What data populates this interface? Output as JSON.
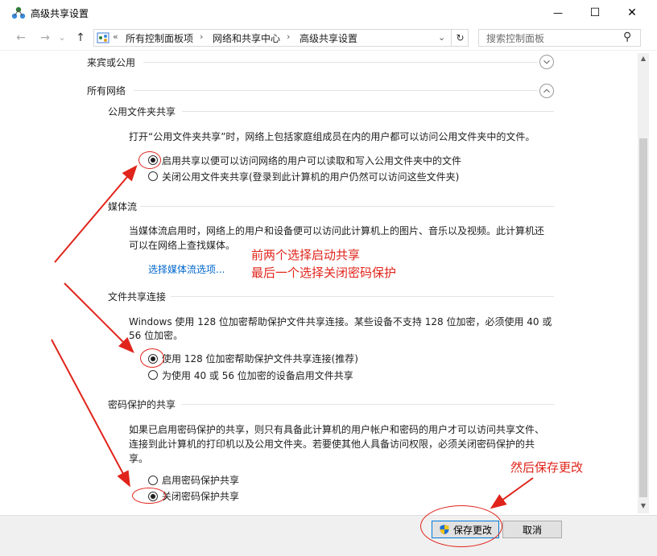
{
  "window": {
    "title": "高级共享设置",
    "minimize_glyph": "—",
    "maximize_glyph": "☐",
    "close_glyph": "✕"
  },
  "nav": {
    "back_glyph": "←",
    "forward_glyph": "→",
    "dropdown_glyph": "⌄",
    "up_glyph": "↑",
    "breadcrumb_prefix": "«",
    "breadcrumbs": [
      "所有控制面板项",
      "网络和共享中心",
      "高级共享设置"
    ],
    "refresh_glyph": "↻",
    "search_placeholder": "搜索控制面板",
    "search_glyph": "⚲"
  },
  "sections": {
    "guest": {
      "label": "来宾或公用"
    },
    "all": {
      "label": "所有网络"
    }
  },
  "public_folder": {
    "heading": "公用文件夹共享",
    "desc": "打开“公用文件夹共享”时，网络上包括家庭组成员在内的用户都可以访问公用文件夹中的文件。",
    "option_on": "启用共享以便可以访问网络的用户可以读取和写入公用文件夹中的文件",
    "option_off": "关闭公用文件夹共享(登录到此计算机的用户仍然可以访问这些文件夹)",
    "selected": "option_on"
  },
  "media": {
    "heading": "媒体流",
    "desc_line1": "当媒体流启用时，网络上的用户和设备便可以访问此计算机上的图片、音乐以及视频。此计算机还",
    "desc_line2": "可以在网络上查找媒体。",
    "link": "选择媒体流选项..."
  },
  "file_sharing": {
    "heading": "文件共享连接",
    "desc_line1": "Windows 使用 128 位加密帮助保护文件共享连接。某些设备不支持 128 位加密，必须使用 40 或",
    "desc_line2": "56 位加密。",
    "option_128": "使用 128 位加密帮助保护文件共享连接(推荐)",
    "option_40_56": "为使用 40 或 56 位加密的设备启用文件共享",
    "selected": "option_128"
  },
  "password": {
    "heading": "密码保护的共享",
    "desc_line1": "如果已启用密码保护的共享，则只有具备此计算机的用户帐户和密码的用户才可以访问共享文件、",
    "desc_line2": "连接到此计算机的打印机以及公用文件夹。若要使其他人具备访问权限，必须关闭密码保护的共",
    "desc_line3": "享。",
    "option_on": "启用密码保护共享",
    "option_off": "关闭密码保护共享",
    "selected": "option_off"
  },
  "annotations": {
    "note_line1": "前两个选择启动共享",
    "note_line2": "最后一个选择关闭密码保护",
    "save_note": "然后保存更改",
    "color": "#e0241b"
  },
  "footer": {
    "save_label": "保存更改",
    "cancel_label": "取消"
  },
  "colors": {
    "link": "#0066cc",
    "accent": "#0078d7"
  }
}
